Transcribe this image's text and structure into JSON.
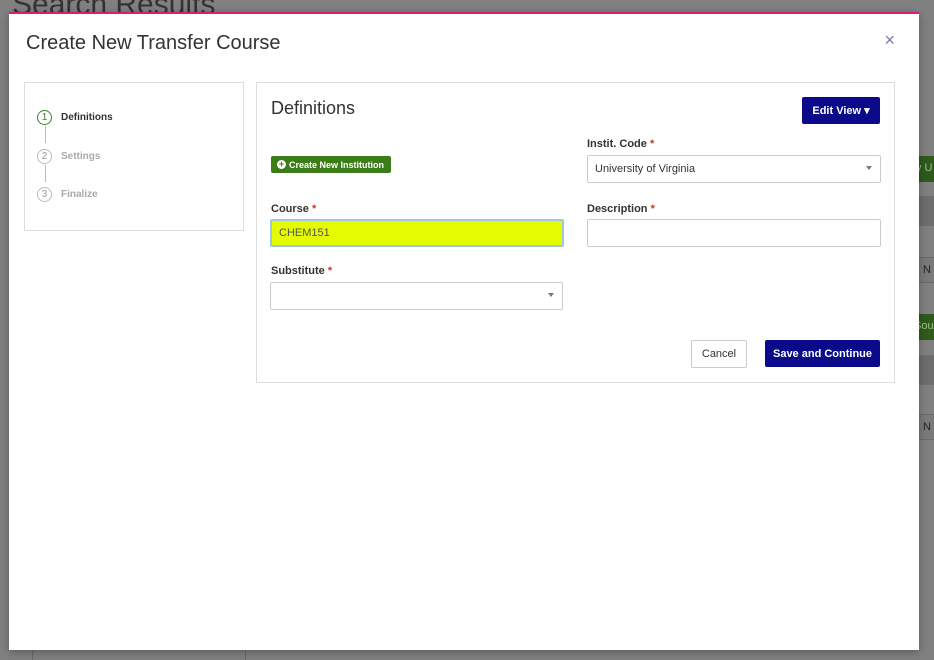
{
  "background": {
    "page_title": "Search Results",
    "fragments": [
      "y U",
      "N",
      "Sou",
      "N"
    ]
  },
  "modal": {
    "title": "Create New Transfer Course",
    "close_glyph": "×"
  },
  "steps": [
    {
      "number": "1",
      "label": "Definitions",
      "active": true
    },
    {
      "number": "2",
      "label": "Settings",
      "active": false
    },
    {
      "number": "3",
      "label": "Finalize",
      "active": false
    }
  ],
  "panel": {
    "title": "Definitions",
    "edit_view_label": "Edit View ▾",
    "create_institution_label": "Create New Institution",
    "fields": {
      "instit_code": {
        "label": "Instit. Code",
        "required_mark": "*",
        "value": "University of Virginia"
      },
      "course": {
        "label": "Course",
        "required_mark": "*",
        "value": "CHEM151"
      },
      "description": {
        "label": "Description",
        "required_mark": "*",
        "value": ""
      },
      "substitute": {
        "label": "Substitute",
        "required_mark": "*",
        "value": ""
      }
    },
    "cancel_label": "Cancel",
    "save_label": "Save and Continue"
  },
  "colors": {
    "accent_navy": "#0a0a8a",
    "accent_green": "#3d7d19",
    "highlight_field": "#e5fb00",
    "modal_top_border": "#d11f7a"
  }
}
